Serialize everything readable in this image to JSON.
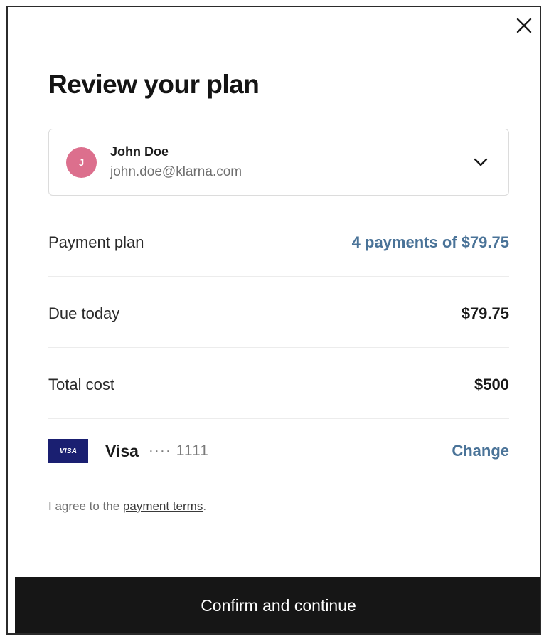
{
  "modal": {
    "title": "Review your plan",
    "close_icon": "close-icon"
  },
  "account": {
    "avatar_initial": "J",
    "avatar_color": "#dc6f8d",
    "name": "John Doe",
    "email": "john.doe@klarna.com",
    "expand_icon": "chevron-down-icon"
  },
  "summary": {
    "payment_plan_label": "Payment plan",
    "payment_plan_value": "4 payments of $79.75",
    "due_today_label": "Due today",
    "due_today_value": "$79.75",
    "total_cost_label": "Total cost",
    "total_cost_value": "$500"
  },
  "payment_method": {
    "badge_text": "VISA",
    "brand": "Visa",
    "masked_number": "···· 1111",
    "change_label": "Change",
    "accent_color": "#4a7398"
  },
  "terms": {
    "prefix": "I agree to the ",
    "link_text": "payment terms",
    "suffix": "."
  },
  "actions": {
    "confirm_label": "Confirm and continue"
  }
}
